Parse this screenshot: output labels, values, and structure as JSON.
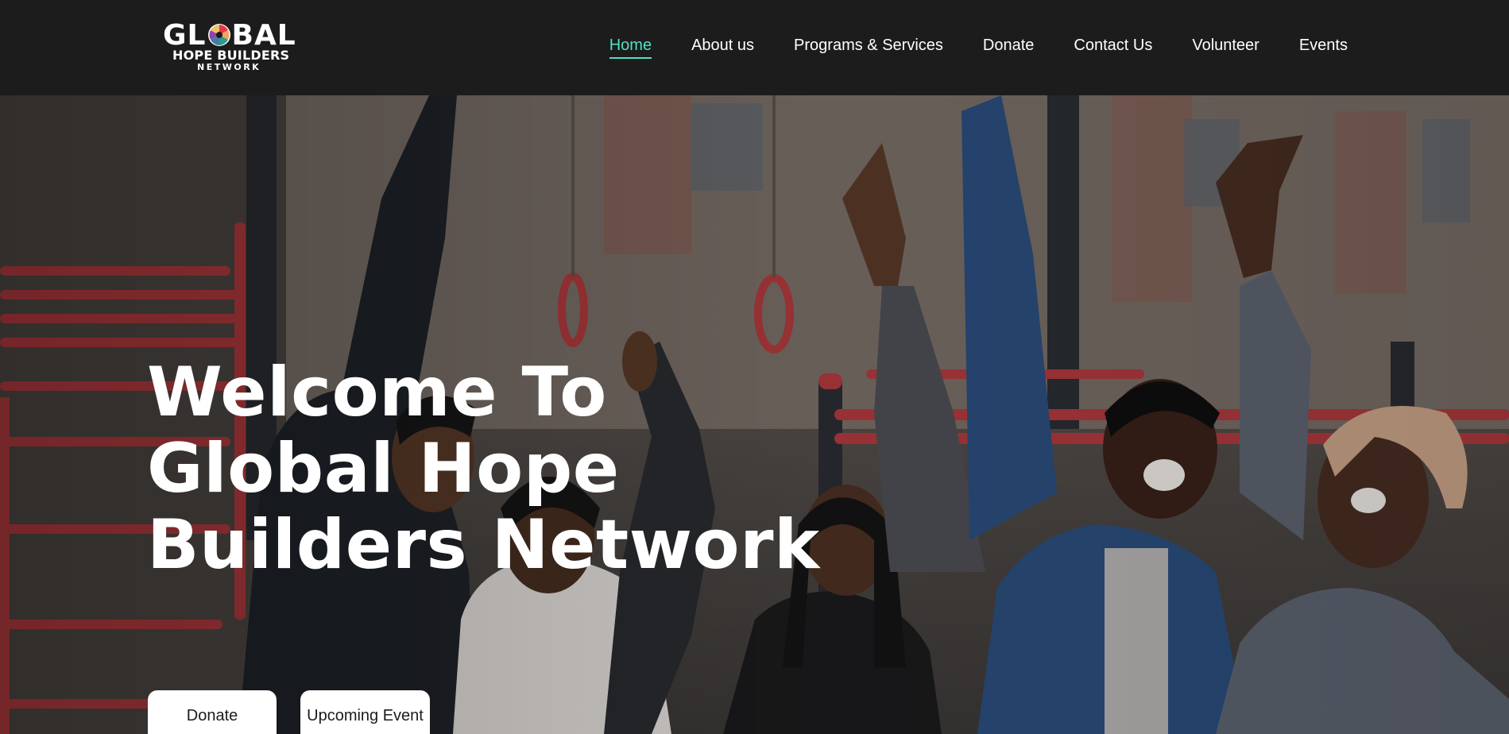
{
  "logo": {
    "line1_left": "GL",
    "line1_right": "BAL",
    "line2": "HOPE BUILDERS",
    "line3": "NETWORK",
    "mark_icon": "colorful-pinwheel-icon"
  },
  "nav": {
    "items": [
      {
        "label": "Home",
        "active": true
      },
      {
        "label": "About us"
      },
      {
        "label": "Programs & Services"
      },
      {
        "label": "Donate"
      },
      {
        "label": "Contact Us"
      },
      {
        "label": "Volunteer"
      },
      {
        "label": "Events"
      }
    ],
    "active_color": "#4fe0c4"
  },
  "hero": {
    "title_line1": "Welcome To",
    "title_line2": "Global Hope",
    "title_line3": "Builders Network",
    "buttons": {
      "donate": "Donate",
      "upcoming_event": "Upcoming Event"
    }
  },
  "colors": {
    "header_bg": "#1c1c1c",
    "accent": "#4fe0c4",
    "button_bg": "#ffffff"
  }
}
